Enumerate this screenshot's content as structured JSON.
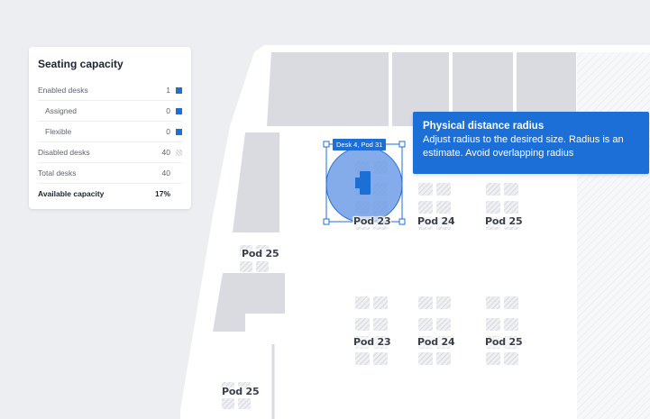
{
  "seating_capacity": {
    "title": "Seating capacity",
    "rows": [
      {
        "label": "Enabled desks",
        "value": "1",
        "swatch": "blue",
        "indent": false
      },
      {
        "label": "Assigned",
        "value": "0",
        "swatch": "blue",
        "indent": true
      },
      {
        "label": "Flexible",
        "value": "0",
        "swatch": "blue",
        "indent": true
      },
      {
        "label": "Disabled desks",
        "value": "40",
        "swatch": "hatched",
        "indent": false
      },
      {
        "label": "Total desks",
        "value": "40",
        "swatch": "none",
        "indent": false
      },
      {
        "label": "Available capacity",
        "value": "17%",
        "swatch": "none",
        "indent": false
      }
    ]
  },
  "tooltip": {
    "title": "Physical distance radius",
    "body": "Adjust radius to the desired size. Radius is an estimate. Avoid overlapping radius"
  },
  "selected_desk": {
    "tag": "Desk 4, Pod 31"
  },
  "pods": {
    "row1": [
      "Pod 23",
      "Pod 24",
      "Pod 25"
    ],
    "row2": [
      "Pod 23",
      "Pod 24",
      "Pod 25"
    ],
    "left_upper": "Pod 25",
    "left_lower": "Pod 25"
  },
  "colors": {
    "accent": "#1d6fd8",
    "radius_fill": "#6f9ee6",
    "room_fill": "#d9dbe1",
    "floor": "#ffffff",
    "background": "#eceef2"
  }
}
